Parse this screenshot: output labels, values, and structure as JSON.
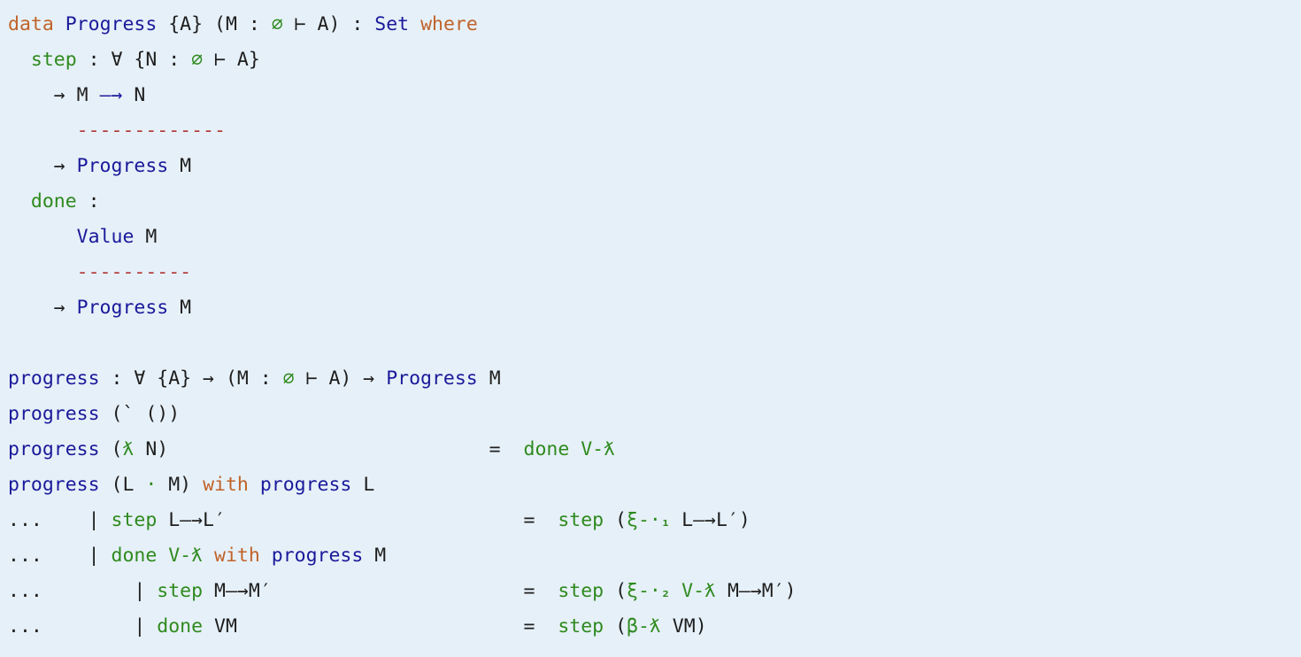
{
  "colors": {
    "background": "#e6f0f8",
    "keyword": "#c0632a",
    "type": "#1a1a9a",
    "constructor": "#2e8a1e",
    "text": "#1e1e1e",
    "rule": "#b33a3a"
  },
  "lines": [
    [
      {
        "t": "data",
        "k": "keyword"
      },
      {
        "t": " "
      },
      {
        "t": "Progress",
        "k": "type"
      },
      {
        "t": " {A} (M : "
      },
      {
        "t": "∅",
        "k": "ctor"
      },
      {
        "t": " ⊢ A) : "
      },
      {
        "t": "Set",
        "k": "type"
      },
      {
        "t": " "
      },
      {
        "t": "where",
        "k": "keyword"
      }
    ],
    [
      {
        "t": "  "
      },
      {
        "t": "step",
        "k": "ctor"
      },
      {
        "t": " : ∀ {N : "
      },
      {
        "t": "∅",
        "k": "ctor"
      },
      {
        "t": " ⊢ A}"
      }
    ],
    [
      {
        "t": "    → M "
      },
      {
        "t": "—→",
        "k": "type"
      },
      {
        "t": " N"
      }
    ],
    [
      {
        "t": "      "
      },
      {
        "t": "-------------",
        "k": "rule"
      }
    ],
    [
      {
        "t": "    → "
      },
      {
        "t": "Progress",
        "k": "type"
      },
      {
        "t": " M"
      }
    ],
    [
      {
        "t": "  "
      },
      {
        "t": "done",
        "k": "ctor"
      },
      {
        "t": " :"
      }
    ],
    [
      {
        "t": "      "
      },
      {
        "t": "Value",
        "k": "type"
      },
      {
        "t": " M"
      }
    ],
    [
      {
        "t": "      "
      },
      {
        "t": "----------",
        "k": "rule"
      }
    ],
    [
      {
        "t": "    → "
      },
      {
        "t": "Progress",
        "k": "type"
      },
      {
        "t": " M"
      }
    ],
    [],
    [
      {
        "t": "progress",
        "k": "type"
      },
      {
        "t": " : ∀ {A} → (M : "
      },
      {
        "t": "∅",
        "k": "ctor"
      },
      {
        "t": " ⊢ A) → "
      },
      {
        "t": "Progress",
        "k": "type"
      },
      {
        "t": " M"
      }
    ],
    [
      {
        "t": "progress",
        "k": "type"
      },
      {
        "t": " (` ())"
      }
    ],
    [
      {
        "t": "progress",
        "k": "type"
      },
      {
        "t": " ("
      },
      {
        "t": "ƛ",
        "k": "ctor"
      },
      {
        "t": " N)                            =  "
      },
      {
        "t": "done V-ƛ",
        "k": "ctor"
      }
    ],
    [
      {
        "t": "progress",
        "k": "type"
      },
      {
        "t": " (L "
      },
      {
        "t": "·",
        "k": "ctor"
      },
      {
        "t": " M) "
      },
      {
        "t": "with",
        "k": "keyword"
      },
      {
        "t": " "
      },
      {
        "t": "progress",
        "k": "type"
      },
      {
        "t": " L"
      }
    ],
    [
      {
        "t": "...    | "
      },
      {
        "t": "step",
        "k": "ctor"
      },
      {
        "t": " L—→L′                          =  "
      },
      {
        "t": "step",
        "k": "ctor"
      },
      {
        "t": " ("
      },
      {
        "t": "ξ-·",
        "k": "ctor"
      },
      {
        "t": "₁",
        "k": "ctor"
      },
      {
        "t": " L—→L′)"
      }
    ],
    [
      {
        "t": "...    | "
      },
      {
        "t": "done V-ƛ",
        "k": "ctor"
      },
      {
        "t": " "
      },
      {
        "t": "with",
        "k": "keyword"
      },
      {
        "t": " "
      },
      {
        "t": "progress",
        "k": "type"
      },
      {
        "t": " M"
      }
    ],
    [
      {
        "t": "...        | "
      },
      {
        "t": "step",
        "k": "ctor"
      },
      {
        "t": " M—→M′                      =  "
      },
      {
        "t": "step",
        "k": "ctor"
      },
      {
        "t": " ("
      },
      {
        "t": "ξ-·",
        "k": "ctor"
      },
      {
        "t": "₂",
        "k": "ctor"
      },
      {
        "t": " "
      },
      {
        "t": "V-ƛ",
        "k": "ctor"
      },
      {
        "t": " M—→M′)"
      }
    ],
    [
      {
        "t": "...        | "
      },
      {
        "t": "done",
        "k": "ctor"
      },
      {
        "t": " VM                         =  "
      },
      {
        "t": "step",
        "k": "ctor"
      },
      {
        "t": " ("
      },
      {
        "t": "β-ƛ",
        "k": "ctor"
      },
      {
        "t": " VM)"
      }
    ]
  ]
}
